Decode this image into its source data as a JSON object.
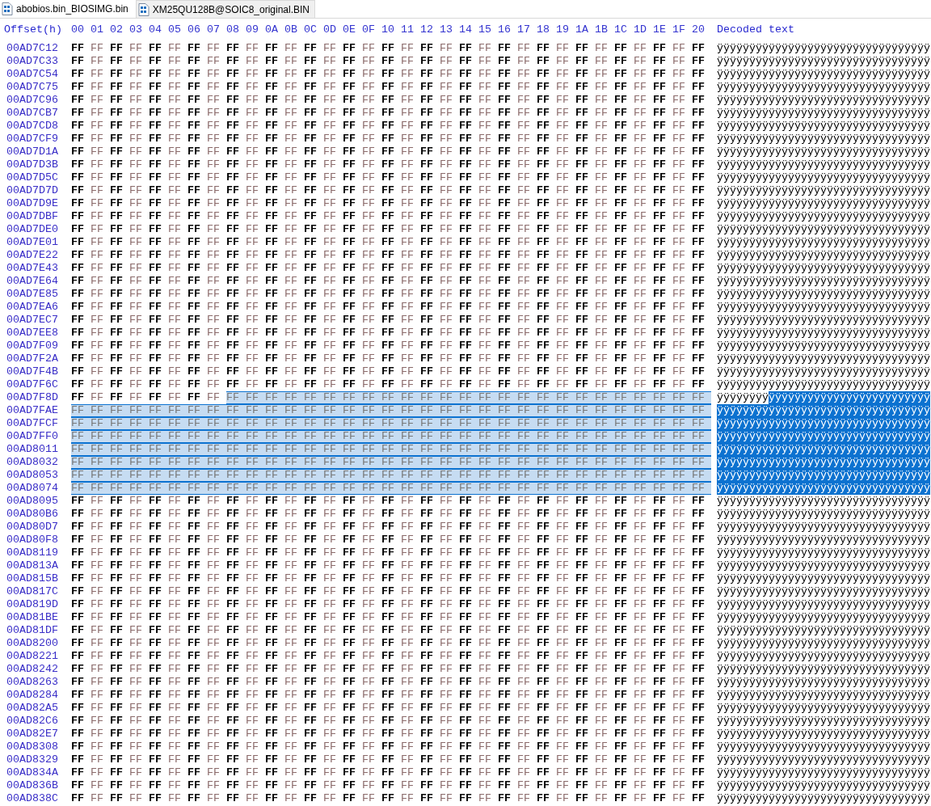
{
  "tabs": [
    {
      "label": "abobios.bin_BIOSIMG.bin",
      "selected": true
    },
    {
      "label": "XM25QU128B@SOIC8_original.BIN",
      "selected": false
    }
  ],
  "header": {
    "offset_label": "Offset(h)",
    "columns": [
      "00",
      "01",
      "02",
      "03",
      "04",
      "05",
      "06",
      "07",
      "08",
      "09",
      "0A",
      "0B",
      "0C",
      "0D",
      "0E",
      "0F",
      "10",
      "11",
      "12",
      "13",
      "14",
      "15",
      "16",
      "17",
      "18",
      "19",
      "1A",
      "1B",
      "1C",
      "1D",
      "1E",
      "1F",
      "20"
    ],
    "text_label": "Decoded text"
  },
  "rows": [
    {
      "offset": "00AD7C12",
      "segments": [
        {
          "bytes": "FF FF FF FF FF FF FF FF FF FF FF FF FF FF FF FF FF FF FF FF FF FF FF FF FF FF FF FF FF FF FF FF FF",
          "text": "ÿÿÿÿÿÿÿÿÿÿÿÿÿÿÿÿÿÿÿÿÿÿÿÿÿÿÿÿÿÿÿÿÿ",
          "selected": false
        }
      ]
    },
    {
      "offset": "00AD7C33",
      "segments": [
        {
          "bytes": "FF FF FF FF FF FF FF FF FF FF FF FF FF FF FF FF FF FF FF FF FF FF FF FF FF FF FF FF FF FF FF FF FF",
          "text": "ÿÿÿÿÿÿÿÿÿÿÿÿÿÿÿÿÿÿÿÿÿÿÿÿÿÿÿÿÿÿÿÿÿ",
          "selected": false
        }
      ]
    },
    {
      "offset": "00AD7C54",
      "segments": [
        {
          "bytes": "FF FF FF FF FF FF FF FF FF FF FF FF FF FF FF FF FF FF FF FF FF FF FF FF FF FF FF FF FF FF FF FF FF",
          "text": "ÿÿÿÿÿÿÿÿÿÿÿÿÿÿÿÿÿÿÿÿÿÿÿÿÿÿÿÿÿÿÿÿÿ",
          "selected": false
        }
      ]
    },
    {
      "offset": "00AD7C75",
      "segments": [
        {
          "bytes": "FF FF FF FF FF FF FF FF FF FF FF FF FF FF FF FF FF FF FF FF FF FF FF FF FF FF FF FF FF FF FF FF FF",
          "text": "ÿÿÿÿÿÿÿÿÿÿÿÿÿÿÿÿÿÿÿÿÿÿÿÿÿÿÿÿÿÿÿÿÿ",
          "selected": false
        }
      ]
    },
    {
      "offset": "00AD7C96",
      "segments": [
        {
          "bytes": "FF FF FF FF FF FF FF FF FF FF FF FF FF FF FF FF FF FF FF FF FF FF FF FF FF FF FF FF FF FF FF FF FF",
          "text": "ÿÿÿÿÿÿÿÿÿÿÿÿÿÿÿÿÿÿÿÿÿÿÿÿÿÿÿÿÿÿÿÿÿ",
          "selected": false
        }
      ]
    },
    {
      "offset": "00AD7CB7",
      "segments": [
        {
          "bytes": "FF FF FF FF FF FF FF FF FF FF FF FF FF FF FF FF FF FF FF FF FF FF FF FF FF FF FF FF FF FF FF FF FF",
          "text": "ÿÿÿÿÿÿÿÿÿÿÿÿÿÿÿÿÿÿÿÿÿÿÿÿÿÿÿÿÿÿÿÿÿ",
          "selected": false
        }
      ]
    },
    {
      "offset": "00AD7CD8",
      "segments": [
        {
          "bytes": "FF FF FF FF FF FF FF FF FF FF FF FF FF FF FF FF FF FF FF FF FF FF FF FF FF FF FF FF FF FF FF FF FF",
          "text": "ÿÿÿÿÿÿÿÿÿÿÿÿÿÿÿÿÿÿÿÿÿÿÿÿÿÿÿÿÿÿÿÿÿ",
          "selected": false
        }
      ]
    },
    {
      "offset": "00AD7CF9",
      "segments": [
        {
          "bytes": "FF FF FF FF FF FF FF FF FF FF FF FF FF FF FF FF FF FF FF FF FF FF FF FF FF FF FF FF FF FF FF FF FF",
          "text": "ÿÿÿÿÿÿÿÿÿÿÿÿÿÿÿÿÿÿÿÿÿÿÿÿÿÿÿÿÿÿÿÿÿ",
          "selected": false
        }
      ]
    },
    {
      "offset": "00AD7D1A",
      "segments": [
        {
          "bytes": "FF FF FF FF FF FF FF FF FF FF FF FF FF FF FF FF FF FF FF FF FF FF FF FF FF FF FF FF FF FF FF FF FF",
          "text": "ÿÿÿÿÿÿÿÿÿÿÿÿÿÿÿÿÿÿÿÿÿÿÿÿÿÿÿÿÿÿÿÿÿ",
          "selected": false
        }
      ]
    },
    {
      "offset": "00AD7D3B",
      "segments": [
        {
          "bytes": "FF FF FF FF FF FF FF FF FF FF FF FF FF FF FF FF FF FF FF FF FF FF FF FF FF FF FF FF FF FF FF FF FF",
          "text": "ÿÿÿÿÿÿÿÿÿÿÿÿÿÿÿÿÿÿÿÿÿÿÿÿÿÿÿÿÿÿÿÿÿ",
          "selected": false
        }
      ]
    },
    {
      "offset": "00AD7D5C",
      "segments": [
        {
          "bytes": "FF FF FF FF FF FF FF FF FF FF FF FF FF FF FF FF FF FF FF FF FF FF FF FF FF FF FF FF FF FF FF FF FF",
          "text": "ÿÿÿÿÿÿÿÿÿÿÿÿÿÿÿÿÿÿÿÿÿÿÿÿÿÿÿÿÿÿÿÿÿ",
          "selected": false
        }
      ]
    },
    {
      "offset": "00AD7D7D",
      "segments": [
        {
          "bytes": "FF FF FF FF FF FF FF FF FF FF FF FF FF FF FF FF FF FF FF FF FF FF FF FF FF FF FF FF FF FF FF FF FF",
          "text": "ÿÿÿÿÿÿÿÿÿÿÿÿÿÿÿÿÿÿÿÿÿÿÿÿÿÿÿÿÿÿÿÿÿ",
          "selected": false
        }
      ]
    },
    {
      "offset": "00AD7D9E",
      "segments": [
        {
          "bytes": "FF FF FF FF FF FF FF FF FF FF FF FF FF FF FF FF FF FF FF FF FF FF FF FF FF FF FF FF FF FF FF FF FF",
          "text": "ÿÿÿÿÿÿÿÿÿÿÿÿÿÿÿÿÿÿÿÿÿÿÿÿÿÿÿÿÿÿÿÿÿ",
          "selected": false
        }
      ]
    },
    {
      "offset": "00AD7DBF",
      "segments": [
        {
          "bytes": "FF FF FF FF FF FF FF FF FF FF FF FF FF FF FF FF FF FF FF FF FF FF FF FF FF FF FF FF FF FF FF FF FF",
          "text": "ÿÿÿÿÿÿÿÿÿÿÿÿÿÿÿÿÿÿÿÿÿÿÿÿÿÿÿÿÿÿÿÿÿ",
          "selected": false
        }
      ]
    },
    {
      "offset": "00AD7DE0",
      "segments": [
        {
          "bytes": "FF FF FF FF FF FF FF FF FF FF FF FF FF FF FF FF FF FF FF FF FF FF FF FF FF FF FF FF FF FF FF FF FF",
          "text": "ÿÿÿÿÿÿÿÿÿÿÿÿÿÿÿÿÿÿÿÿÿÿÿÿÿÿÿÿÿÿÿÿÿ",
          "selected": false
        }
      ]
    },
    {
      "offset": "00AD7E01",
      "segments": [
        {
          "bytes": "FF FF FF FF FF FF FF FF FF FF FF FF FF FF FF FF FF FF FF FF FF FF FF FF FF FF FF FF FF FF FF FF FF",
          "text": "ÿÿÿÿÿÿÿÿÿÿÿÿÿÿÿÿÿÿÿÿÿÿÿÿÿÿÿÿÿÿÿÿÿ",
          "selected": false
        }
      ]
    },
    {
      "offset": "00AD7E22",
      "segments": [
        {
          "bytes": "FF FF FF FF FF FF FF FF FF FF FF FF FF FF FF FF FF FF FF FF FF FF FF FF FF FF FF FF FF FF FF FF FF",
          "text": "ÿÿÿÿÿÿÿÿÿÿÿÿÿÿÿÿÿÿÿÿÿÿÿÿÿÿÿÿÿÿÿÿÿ",
          "selected": false
        }
      ]
    },
    {
      "offset": "00AD7E43",
      "segments": [
        {
          "bytes": "FF FF FF FF FF FF FF FF FF FF FF FF FF FF FF FF FF FF FF FF FF FF FF FF FF FF FF FF FF FF FF FF FF",
          "text": "ÿÿÿÿÿÿÿÿÿÿÿÿÿÿÿÿÿÿÿÿÿÿÿÿÿÿÿÿÿÿÿÿÿ",
          "selected": false
        }
      ]
    },
    {
      "offset": "00AD7E64",
      "segments": [
        {
          "bytes": "FF FF FF FF FF FF FF FF FF FF FF FF FF FF FF FF FF FF FF FF FF FF FF FF FF FF FF FF FF FF FF FF FF",
          "text": "ÿÿÿÿÿÿÿÿÿÿÿÿÿÿÿÿÿÿÿÿÿÿÿÿÿÿÿÿÿÿÿÿÿ",
          "selected": false
        }
      ]
    },
    {
      "offset": "00AD7E85",
      "segments": [
        {
          "bytes": "FF FF FF FF FF FF FF FF FF FF FF FF FF FF FF FF FF FF FF FF FF FF FF FF FF FF FF FF FF FF FF FF FF",
          "text": "ÿÿÿÿÿÿÿÿÿÿÿÿÿÿÿÿÿÿÿÿÿÿÿÿÿÿÿÿÿÿÿÿÿ",
          "selected": false
        }
      ]
    },
    {
      "offset": "00AD7EA6",
      "segments": [
        {
          "bytes": "FF FF FF FF FF FF FF FF FF FF FF FF FF FF FF FF FF FF FF FF FF FF FF FF FF FF FF FF FF FF FF FF FF",
          "text": "ÿÿÿÿÿÿÿÿÿÿÿÿÿÿÿÿÿÿÿÿÿÿÿÿÿÿÿÿÿÿÿÿÿ",
          "selected": false
        }
      ]
    },
    {
      "offset": "00AD7EC7",
      "segments": [
        {
          "bytes": "FF FF FF FF FF FF FF FF FF FF FF FF FF FF FF FF FF FF FF FF FF FF FF FF FF FF FF FF FF FF FF FF FF",
          "text": "ÿÿÿÿÿÿÿÿÿÿÿÿÿÿÿÿÿÿÿÿÿÿÿÿÿÿÿÿÿÿÿÿÿ",
          "selected": false
        }
      ]
    },
    {
      "offset": "00AD7EE8",
      "segments": [
        {
          "bytes": "FF FF FF FF FF FF FF FF FF FF FF FF FF FF FF FF FF FF FF FF FF FF FF FF FF FF FF FF FF FF FF FF FF",
          "text": "ÿÿÿÿÿÿÿÿÿÿÿÿÿÿÿÿÿÿÿÿÿÿÿÿÿÿÿÿÿÿÿÿÿ",
          "selected": false
        }
      ]
    },
    {
      "offset": "00AD7F09",
      "segments": [
        {
          "bytes": "FF FF FF FF FF FF FF FF FF FF FF FF FF FF FF FF FF FF FF FF FF FF FF FF FF FF FF FF FF FF FF FF FF",
          "text": "ÿÿÿÿÿÿÿÿÿÿÿÿÿÿÿÿÿÿÿÿÿÿÿÿÿÿÿÿÿÿÿÿÿ",
          "selected": false
        }
      ]
    },
    {
      "offset": "00AD7F2A",
      "segments": [
        {
          "bytes": "FF FF FF FF FF FF FF FF FF FF FF FF FF FF FF FF FF FF FF FF FF FF FF FF FF FF FF FF FF FF FF FF FF",
          "text": "ÿÿÿÿÿÿÿÿÿÿÿÿÿÿÿÿÿÿÿÿÿÿÿÿÿÿÿÿÿÿÿÿÿ",
          "selected": false
        }
      ]
    },
    {
      "offset": "00AD7F4B",
      "segments": [
        {
          "bytes": "FF FF FF FF FF FF FF FF FF FF FF FF FF FF FF FF FF FF FF FF FF FF FF FF FF FF FF FF FF FF FF FF FF",
          "text": "ÿÿÿÿÿÿÿÿÿÿÿÿÿÿÿÿÿÿÿÿÿÿÿÿÿÿÿÿÿÿÿÿÿ",
          "selected": false
        }
      ]
    },
    {
      "offset": "00AD7F6C",
      "segments": [
        {
          "bytes": "FF FF FF FF FF FF FF FF FF FF FF FF FF FF FF FF FF FF FF FF FF FF FF FF FF FF FF FF FF FF FF FF FF",
          "text": "ÿÿÿÿÿÿÿÿÿÿÿÿÿÿÿÿÿÿÿÿÿÿÿÿÿÿÿÿÿÿÿÿÿ",
          "selected": false
        }
      ]
    },
    {
      "offset": "00AD7F8D",
      "segments": [
        {
          "bytes": "FF FF FF FF FF FF FF FF",
          "text": "ÿÿÿÿÿÿÿÿ",
          "selected": false
        },
        {
          "bytes": "FF FF FF FF FF FF FF FF FF FF FF FF FF FF FF FF FF FF FF FF FF FF FF FF FF",
          "text": "ÿÿÿÿÿÿÿÿÿÿÿÿÿÿÿÿÿÿÿÿÿÿÿÿÿ",
          "selected": true
        }
      ]
    },
    {
      "offset": "00AD7FAE",
      "segments": [
        {
          "bytes": "FF FF FF FF FF FF FF FF FF FF FF FF FF FF FF FF FF FF FF FF FF FF FF FF FF FF FF FF FF FF FF FF FF",
          "text": "ÿÿÿÿÿÿÿÿÿÿÿÿÿÿÿÿÿÿÿÿÿÿÿÿÿÿÿÿÿÿÿÿÿ",
          "selected": true
        }
      ]
    },
    {
      "offset": "00AD7FCF",
      "segments": [
        {
          "bytes": "FF FF FF FF FF FF FF FF FF FF FF FF FF FF FF FF FF FF FF FF FF FF FF FF FF FF FF FF FF FF FF FF FF",
          "text": "ÿÿÿÿÿÿÿÿÿÿÿÿÿÿÿÿÿÿÿÿÿÿÿÿÿÿÿÿÿÿÿÿÿ",
          "selected": true
        }
      ]
    },
    {
      "offset": "00AD7FF0",
      "segments": [
        {
          "bytes": "FF FF FF FF FF FF FF FF FF FF FF FF FF FF FF FF FF FF FF FF FF FF FF FF FF FF FF FF FF FF FF FF FF",
          "text": "ÿÿÿÿÿÿÿÿÿÿÿÿÿÿÿÿÿÿÿÿÿÿÿÿÿÿÿÿÿÿÿÿÿ",
          "selected": true
        }
      ]
    },
    {
      "offset": "00AD8011",
      "segments": [
        {
          "bytes": "FF FF FF FF FF FF FF FF FF FF FF FF FF FF FF FF FF FF FF FF FF FF FF FF FF FF FF FF FF FF FF FF FF",
          "text": "ÿÿÿÿÿÿÿÿÿÿÿÿÿÿÿÿÿÿÿÿÿÿÿÿÿÿÿÿÿÿÿÿÿ",
          "selected": true
        }
      ]
    },
    {
      "offset": "00AD8032",
      "segments": [
        {
          "bytes": "FF FF FF FF FF FF FF FF FF FF FF FF FF FF FF FF FF FF FF FF FF FF FF FF FF FF FF FF FF FF FF FF FF",
          "text": "ÿÿÿÿÿÿÿÿÿÿÿÿÿÿÿÿÿÿÿÿÿÿÿÿÿÿÿÿÿÿÿÿÿ",
          "selected": true
        }
      ]
    },
    {
      "offset": "00AD8053",
      "segments": [
        {
          "bytes": "FF FF FF FF FF FF FF FF FF FF FF FF FF FF FF FF FF FF FF FF FF FF FF FF FF FF FF FF FF FF FF FF FF",
          "text": "ÿÿÿÿÿÿÿÿÿÿÿÿÿÿÿÿÿÿÿÿÿÿÿÿÿÿÿÿÿÿÿÿÿ",
          "selected": true
        }
      ]
    },
    {
      "offset": "00AD8074",
      "segments": [
        {
          "bytes": "FF FF FF FF FF FF FF FF FF FF FF FF FF FF FF FF FF FF FF FF FF FF FF FF FF FF FF FF FF FF FF FF FF",
          "text": "ÿÿÿÿÿÿÿÿÿÿÿÿÿÿÿÿÿÿÿÿÿÿÿÿÿÿÿÿÿÿÿÿÿ",
          "selected": true
        }
      ]
    },
    {
      "offset": "00AD8095",
      "segments": [
        {
          "bytes": "FF FF FF FF FF FF FF FF FF FF FF FF FF FF FF FF FF FF FF FF FF FF FF FF FF FF FF FF FF FF FF FF FF",
          "text": "ÿÿÿÿÿÿÿÿÿÿÿÿÿÿÿÿÿÿÿÿÿÿÿÿÿÿÿÿÿÿÿÿÿ",
          "selected": false
        }
      ]
    },
    {
      "offset": "00AD80B6",
      "segments": [
        {
          "bytes": "FF FF FF FF FF FF FF FF FF FF FF FF FF FF FF FF FF FF FF FF FF FF FF FF FF FF FF FF FF FF FF FF FF",
          "text": "ÿÿÿÿÿÿÿÿÿÿÿÿÿÿÿÿÿÿÿÿÿÿÿÿÿÿÿÿÿÿÿÿÿ",
          "selected": false
        }
      ]
    },
    {
      "offset": "00AD80D7",
      "segments": [
        {
          "bytes": "FF FF FF FF FF FF FF FF FF FF FF FF FF FF FF FF FF FF FF FF FF FF FF FF FF FF FF FF FF FF FF FF FF",
          "text": "ÿÿÿÿÿÿÿÿÿÿÿÿÿÿÿÿÿÿÿÿÿÿÿÿÿÿÿÿÿÿÿÿÿ",
          "selected": false
        }
      ]
    },
    {
      "offset": "00AD80F8",
      "segments": [
        {
          "bytes": "FF FF FF FF FF FF FF FF FF FF FF FF FF FF FF FF FF FF FF FF FF FF FF FF FF FF FF FF FF FF FF FF FF",
          "text": "ÿÿÿÿÿÿÿÿÿÿÿÿÿÿÿÿÿÿÿÿÿÿÿÿÿÿÿÿÿÿÿÿÿ",
          "selected": false
        }
      ]
    },
    {
      "offset": "00AD8119",
      "segments": [
        {
          "bytes": "FF FF FF FF FF FF FF FF FF FF FF FF FF FF FF FF FF FF FF FF FF FF FF FF FF FF FF FF FF FF FF FF FF",
          "text": "ÿÿÿÿÿÿÿÿÿÿÿÿÿÿÿÿÿÿÿÿÿÿÿÿÿÿÿÿÿÿÿÿÿ",
          "selected": false
        }
      ]
    },
    {
      "offset": "00AD813A",
      "segments": [
        {
          "bytes": "FF FF FF FF FF FF FF FF FF FF FF FF FF FF FF FF FF FF FF FF FF FF FF FF FF FF FF FF FF FF FF FF FF",
          "text": "ÿÿÿÿÿÿÿÿÿÿÿÿÿÿÿÿÿÿÿÿÿÿÿÿÿÿÿÿÿÿÿÿÿ",
          "selected": false
        }
      ]
    },
    {
      "offset": "00AD815B",
      "segments": [
        {
          "bytes": "FF FF FF FF FF FF FF FF FF FF FF FF FF FF FF FF FF FF FF FF FF FF FF FF FF FF FF FF FF FF FF FF FF",
          "text": "ÿÿÿÿÿÿÿÿÿÿÿÿÿÿÿÿÿÿÿÿÿÿÿÿÿÿÿÿÿÿÿÿÿ",
          "selected": false
        }
      ]
    },
    {
      "offset": "00AD817C",
      "segments": [
        {
          "bytes": "FF FF FF FF FF FF FF FF FF FF FF FF FF FF FF FF FF FF FF FF FF FF FF FF FF FF FF FF FF FF FF FF FF",
          "text": "ÿÿÿÿÿÿÿÿÿÿÿÿÿÿÿÿÿÿÿÿÿÿÿÿÿÿÿÿÿÿÿÿÿ",
          "selected": false
        }
      ]
    },
    {
      "offset": "00AD819D",
      "segments": [
        {
          "bytes": "FF FF FF FF FF FF FF FF FF FF FF FF FF FF FF FF FF FF FF FF FF FF FF FF FF FF FF FF FF FF FF FF FF",
          "text": "ÿÿÿÿÿÿÿÿÿÿÿÿÿÿÿÿÿÿÿÿÿÿÿÿÿÿÿÿÿÿÿÿÿ",
          "selected": false
        }
      ]
    },
    {
      "offset": "00AD81BE",
      "segments": [
        {
          "bytes": "FF FF FF FF FF FF FF FF FF FF FF FF FF FF FF FF FF FF FF FF FF FF FF FF FF FF FF FF FF FF FF FF FF",
          "text": "ÿÿÿÿÿÿÿÿÿÿÿÿÿÿÿÿÿÿÿÿÿÿÿÿÿÿÿÿÿÿÿÿÿ",
          "selected": false
        }
      ]
    },
    {
      "offset": "00AD81DF",
      "segments": [
        {
          "bytes": "FF FF FF FF FF FF FF FF FF FF FF FF FF FF FF FF FF FF FF FF FF FF FF FF FF FF FF FF FF FF FF FF FF",
          "text": "ÿÿÿÿÿÿÿÿÿÿÿÿÿÿÿÿÿÿÿÿÿÿÿÿÿÿÿÿÿÿÿÿÿ",
          "selected": false
        }
      ]
    },
    {
      "offset": "00AD8200",
      "segments": [
        {
          "bytes": "FF FF FF FF FF FF FF FF FF FF FF FF FF FF FF FF FF FF FF FF FF FF FF FF FF FF FF FF FF FF FF FF FF",
          "text": "ÿÿÿÿÿÿÿÿÿÿÿÿÿÿÿÿÿÿÿÿÿÿÿÿÿÿÿÿÿÿÿÿÿ",
          "selected": false
        }
      ]
    },
    {
      "offset": "00AD8221",
      "segments": [
        {
          "bytes": "FF FF FF FF FF FF FF FF FF FF FF FF FF FF FF FF FF FF FF FF FF FF FF FF FF FF FF FF FF FF FF FF FF",
          "text": "ÿÿÿÿÿÿÿÿÿÿÿÿÿÿÿÿÿÿÿÿÿÿÿÿÿÿÿÿÿÿÿÿÿ",
          "selected": false
        }
      ]
    },
    {
      "offset": "00AD8242",
      "segments": [
        {
          "bytes": "FF FF FF FF FF FF FF FF FF FF FF FF FF FF FF FF FF FF FF FF FF FF FF FF FF FF FF FF FF FF FF FF FF",
          "text": "ÿÿÿÿÿÿÿÿÿÿÿÿÿÿÿÿÿÿÿÿÿÿÿÿÿÿÿÿÿÿÿÿÿ",
          "selected": false
        }
      ]
    },
    {
      "offset": "00AD8263",
      "segments": [
        {
          "bytes": "FF FF FF FF FF FF FF FF FF FF FF FF FF FF FF FF FF FF FF FF FF FF FF FF FF FF FF FF FF FF FF FF FF",
          "text": "ÿÿÿÿÿÿÿÿÿÿÿÿÿÿÿÿÿÿÿÿÿÿÿÿÿÿÿÿÿÿÿÿÿ",
          "selected": false
        }
      ]
    },
    {
      "offset": "00AD8284",
      "segments": [
        {
          "bytes": "FF FF FF FF FF FF FF FF FF FF FF FF FF FF FF FF FF FF FF FF FF FF FF FF FF FF FF FF FF FF FF FF FF",
          "text": "ÿÿÿÿÿÿÿÿÿÿÿÿÿÿÿÿÿÿÿÿÿÿÿÿÿÿÿÿÿÿÿÿÿ",
          "selected": false
        }
      ]
    },
    {
      "offset": "00AD82A5",
      "segments": [
        {
          "bytes": "FF FF FF FF FF FF FF FF FF FF FF FF FF FF FF FF FF FF FF FF FF FF FF FF FF FF FF FF FF FF FF FF FF",
          "text": "ÿÿÿÿÿÿÿÿÿÿÿÿÿÿÿÿÿÿÿÿÿÿÿÿÿÿÿÿÿÿÿÿÿ",
          "selected": false
        }
      ]
    },
    {
      "offset": "00AD82C6",
      "segments": [
        {
          "bytes": "FF FF FF FF FF FF FF FF FF FF FF FF FF FF FF FF FF FF FF FF FF FF FF FF FF FF FF FF FF FF FF FF FF",
          "text": "ÿÿÿÿÿÿÿÿÿÿÿÿÿÿÿÿÿÿÿÿÿÿÿÿÿÿÿÿÿÿÿÿÿ",
          "selected": false
        }
      ]
    },
    {
      "offset": "00AD82E7",
      "segments": [
        {
          "bytes": "FF FF FF FF FF FF FF FF FF FF FF FF FF FF FF FF FF FF FF FF FF FF FF FF FF FF FF FF FF FF FF FF FF",
          "text": "ÿÿÿÿÿÿÿÿÿÿÿÿÿÿÿÿÿÿÿÿÿÿÿÿÿÿÿÿÿÿÿÿÿ",
          "selected": false
        }
      ]
    },
    {
      "offset": "00AD8308",
      "segments": [
        {
          "bytes": "FF FF FF FF FF FF FF FF FF FF FF FF FF FF FF FF FF FF FF FF FF FF FF FF FF FF FF FF FF FF FF FF FF",
          "text": "ÿÿÿÿÿÿÿÿÿÿÿÿÿÿÿÿÿÿÿÿÿÿÿÿÿÿÿÿÿÿÿÿÿ",
          "selected": false
        }
      ]
    },
    {
      "offset": "00AD8329",
      "segments": [
        {
          "bytes": "FF FF FF FF FF FF FF FF FF FF FF FF FF FF FF FF FF FF FF FF FF FF FF FF FF FF FF FF FF FF FF FF FF",
          "text": "ÿÿÿÿÿÿÿÿÿÿÿÿÿÿÿÿÿÿÿÿÿÿÿÿÿÿÿÿÿÿÿÿÿ",
          "selected": false
        }
      ]
    },
    {
      "offset": "00AD834A",
      "segments": [
        {
          "bytes": "FF FF FF FF FF FF FF FF FF FF FF FF FF FF FF FF FF FF FF FF FF FF FF FF FF FF FF FF FF FF FF FF FF",
          "text": "ÿÿÿÿÿÿÿÿÿÿÿÿÿÿÿÿÿÿÿÿÿÿÿÿÿÿÿÿÿÿÿÿÿ",
          "selected": false
        }
      ]
    },
    {
      "offset": "00AD836B",
      "segments": [
        {
          "bytes": "FF FF FF FF FF FF FF FF FF FF FF FF FF FF FF FF FF FF FF FF FF FF FF FF FF FF FF FF FF FF FF FF FF",
          "text": "ÿÿÿÿÿÿÿÿÿÿÿÿÿÿÿÿÿÿÿÿÿÿÿÿÿÿÿÿÿÿÿÿÿ",
          "selected": false
        }
      ]
    },
    {
      "offset": "00AD838C",
      "segments": [
        {
          "bytes": "FF FF FF FF FF FF FF FF FF FF FF FF FF FF FF FF FF FF FF FF FF FF FF FF FF FF FF FF FF FF FF FF FF",
          "text": "ÿÿÿÿÿÿÿÿÿÿÿÿÿÿÿÿÿÿÿÿÿÿÿÿÿÿÿÿÿÿÿÿÿ",
          "selected": false
        }
      ]
    }
  ]
}
